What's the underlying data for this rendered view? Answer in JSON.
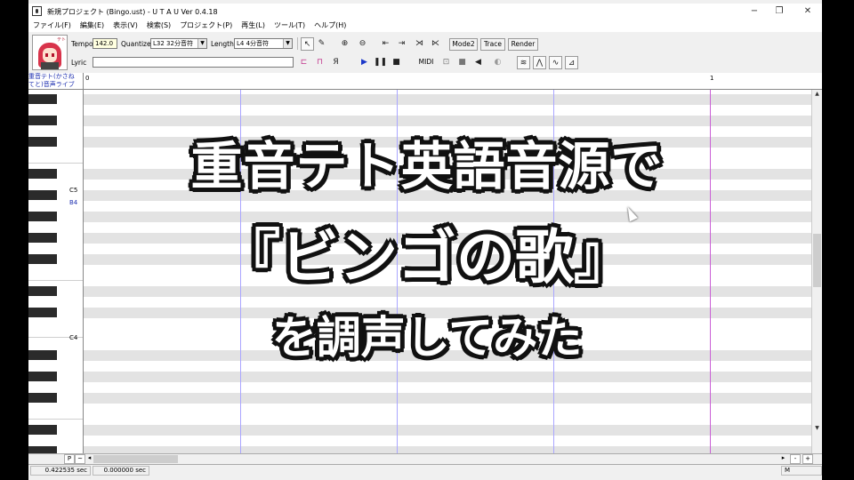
{
  "window": {
    "title": "新規プロジェクト (Bingo.ust) - U T A U Ver 0.4.18",
    "controls": {
      "minimize": "−",
      "maximize": "❐",
      "close": "✕"
    }
  },
  "menu": [
    "ファイル(F)",
    "編集(E)",
    "表示(V)",
    "検索(S)",
    "プロジェクト(P)",
    "再生(L)",
    "ツール(T)",
    "ヘルプ(H)"
  ],
  "toolbar": {
    "avatar_tag": "テト",
    "tempo_label": "Tempo",
    "tempo_value": "142.0",
    "quantize_label": "Quantize",
    "quantize_value": "L32 32分音符",
    "length_label": "Length",
    "length_value": "L4  4分音符",
    "lyric_label": "Lyric",
    "lyric_value": "",
    "mode2": "Mode2",
    "trace": "Trace",
    "render": "Render",
    "midi": "MIDI",
    "tool_icons": [
      "pointer-icon",
      "pencil-icon",
      "zoom-in-icon",
      "zoom-out-icon",
      "go-start-icon",
      "go-end-icon",
      "split-icon",
      "merge-icon"
    ]
  },
  "editor": {
    "singer": [
      "重音テト(かさね",
      "てと)音声ライブ"
    ],
    "ruler": {
      "start": "0",
      "measure": "1"
    },
    "notes": {
      "c5": "C5",
      "b4": "B4",
      "c4": "C4"
    }
  },
  "bottom": {
    "p": "P",
    "tilde": "~",
    "minus": "-",
    "plus": "+",
    "left": "◂",
    "right": "▸"
  },
  "status": {
    "time1": "0.422535 sec",
    "time2": "0.000000 sec",
    "mode": "M"
  },
  "overlay": {
    "line1": "重音テト英語音源で",
    "line2": "『ビンゴの歌』",
    "line3": "を調声してみた"
  },
  "colors": {
    "beat_line": "#aaa6ff",
    "bar_line": "#c95fd6",
    "dark_row": "#e3e3e3"
  }
}
